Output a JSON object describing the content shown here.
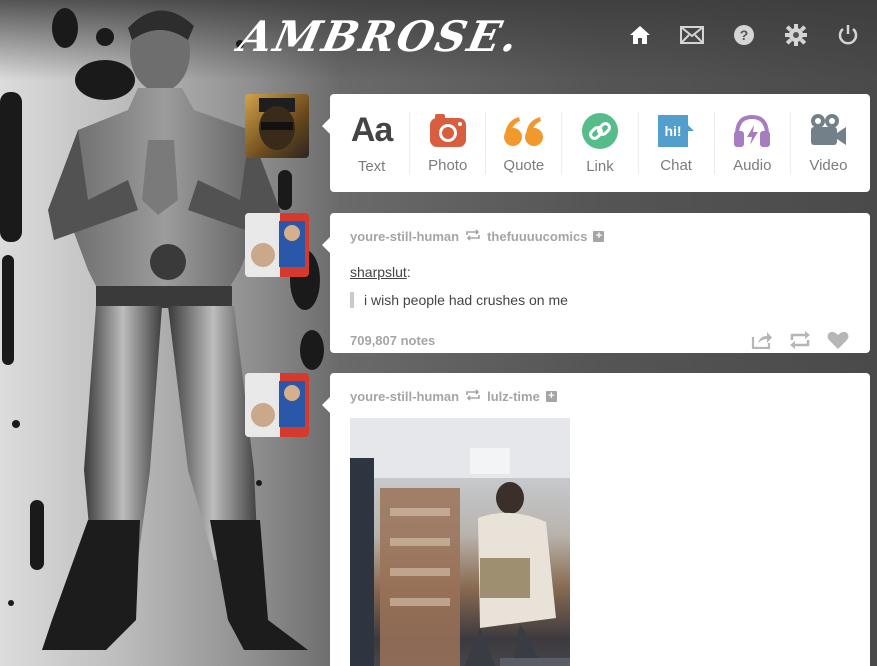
{
  "blog": {
    "logo": "AMBROSE."
  },
  "nav": {
    "icons": [
      "home-icon",
      "mail-icon",
      "help-icon",
      "gear-icon",
      "power-icon"
    ]
  },
  "post_types": [
    {
      "label": "Text",
      "icon": "text-icon",
      "color": "#444444"
    },
    {
      "label": "Photo",
      "icon": "camera-icon",
      "color": "#d95e40"
    },
    {
      "label": "Quote",
      "icon": "quote-icon",
      "color": "#f2992e"
    },
    {
      "label": "Link",
      "icon": "link-icon",
      "color": "#56bc8a"
    },
    {
      "label": "Chat",
      "icon": "chat-icon",
      "color": "#529ecc"
    },
    {
      "label": "Audio",
      "icon": "audio-icon",
      "color": "#a77dc2"
    },
    {
      "label": "Video",
      "icon": "video-icon",
      "color": "#748089"
    }
  ],
  "posts": [
    {
      "author": "youre-still-human",
      "reblogged_from": "thefuuuucomics",
      "source_user": "sharpslut",
      "source_suffix": ":",
      "quote": "i wish people had crushes on me",
      "notes": "709,807 notes"
    },
    {
      "author": "youre-still-human",
      "reblogged_from": "lulz-time"
    }
  ],
  "colors": {
    "meta_text": "#a5a5a5",
    "panel_bg": "#ffffff"
  }
}
